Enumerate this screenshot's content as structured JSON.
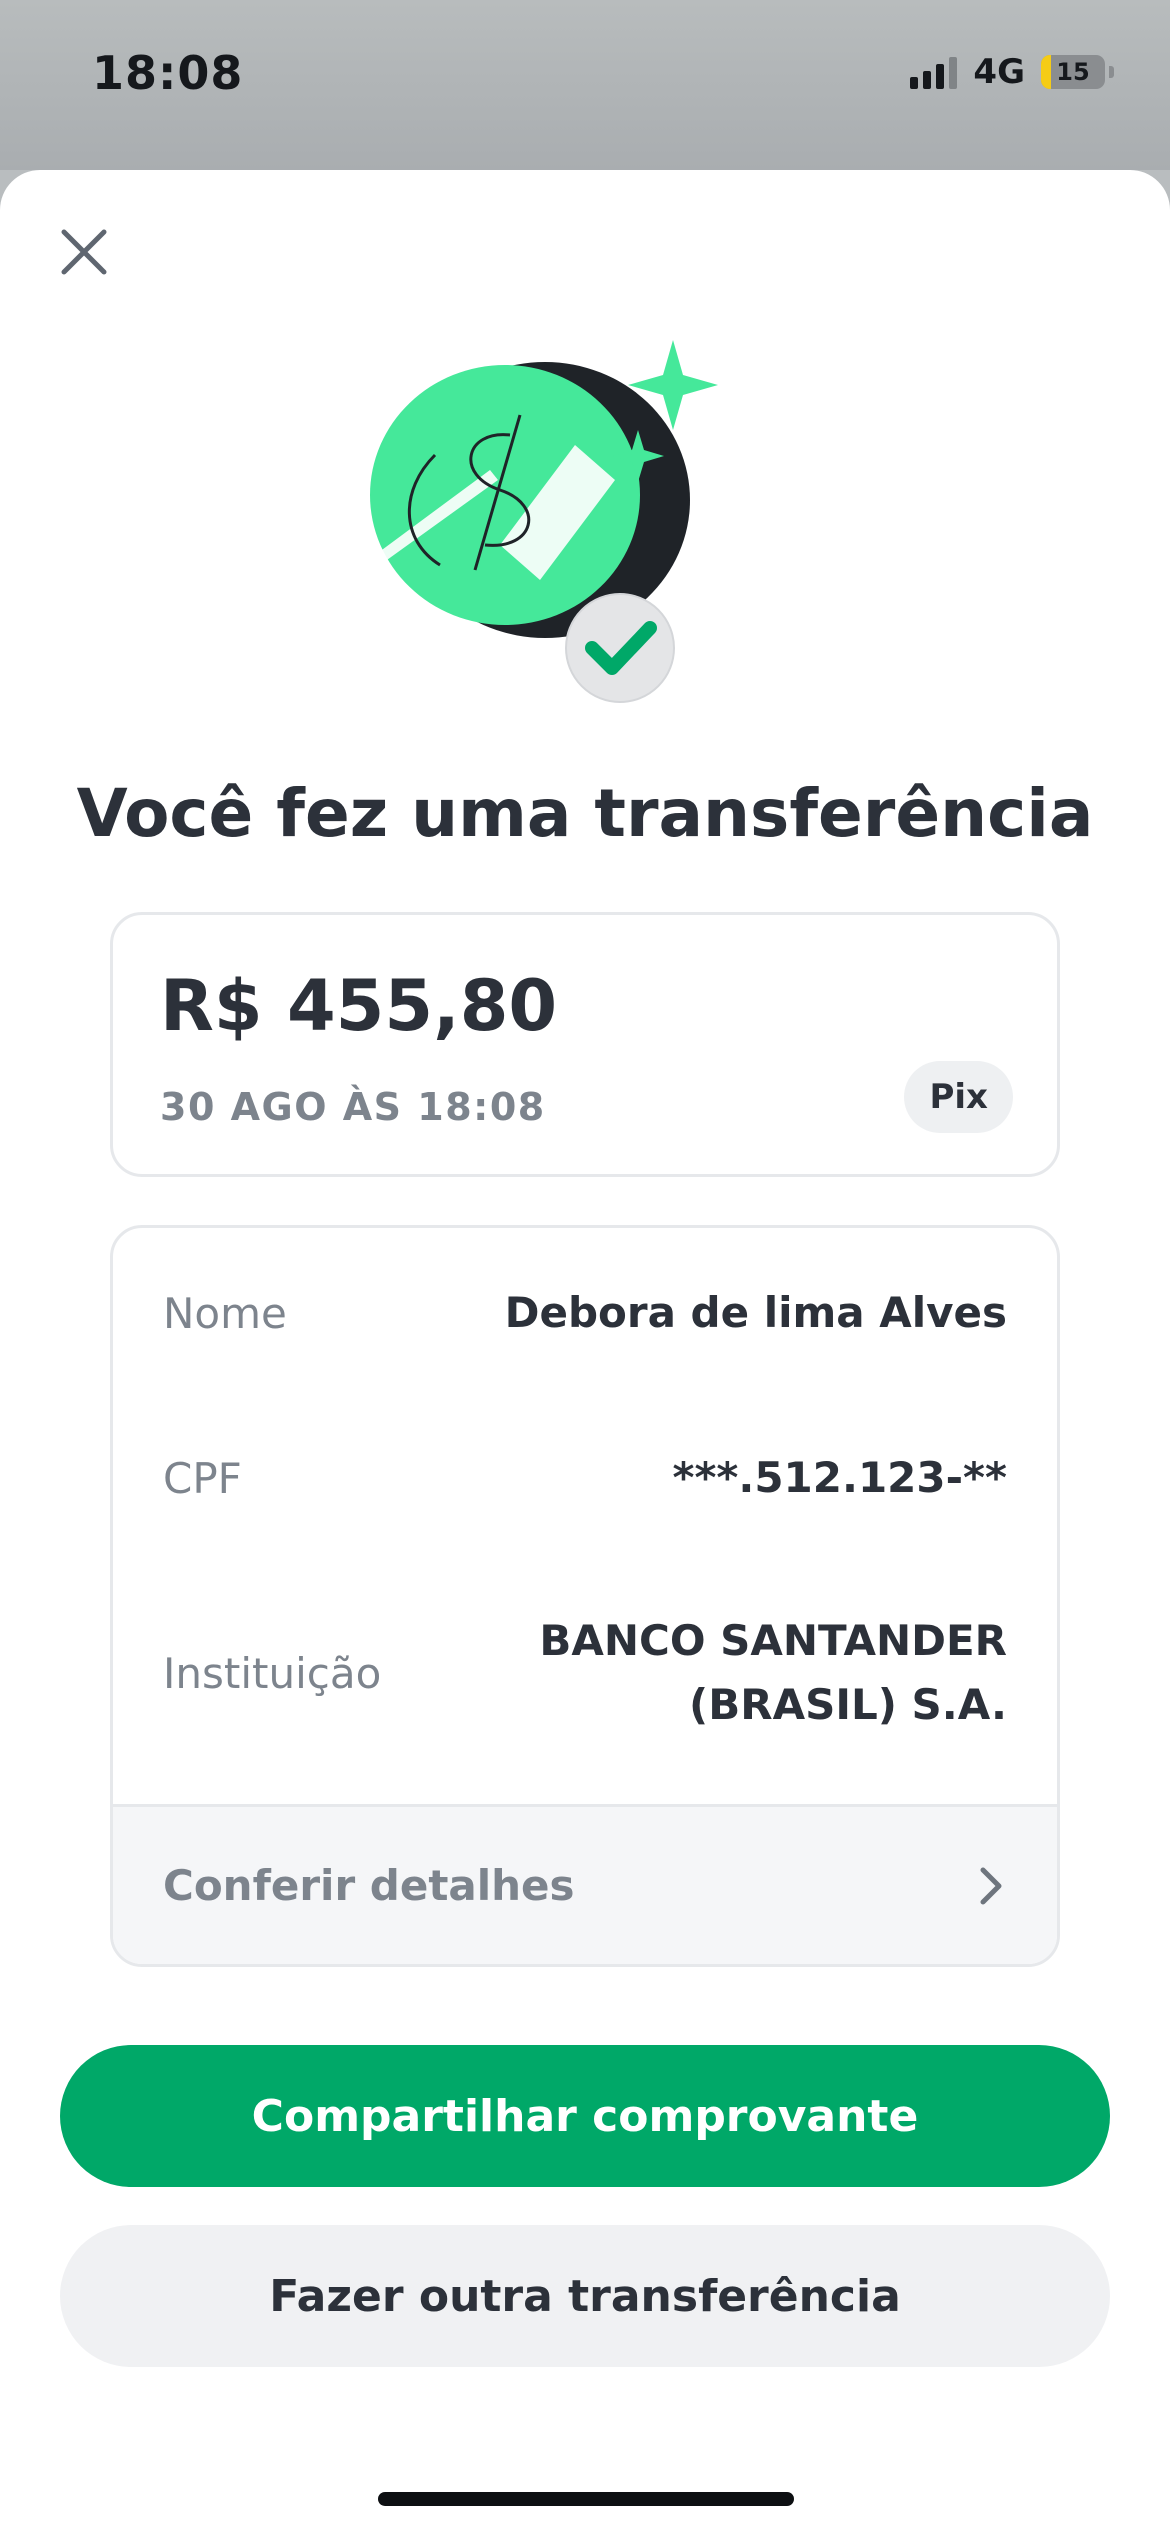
{
  "status_bar": {
    "time": "18:08",
    "network": "4G",
    "battery": "15",
    "battery_level": 0.15,
    "battery_color": "#f5cc16"
  },
  "close_icon": "close-icon",
  "title": "Você fez uma transferência",
  "transfer": {
    "amount": "R$ 455,80",
    "date": "30 AGO ÀS 18:08",
    "method": "Pix"
  },
  "details": {
    "rows": [
      {
        "label": "Nome",
        "value": "Debora de lima Alves"
      },
      {
        "label": "CPF",
        "value": "***.512.123-**"
      },
      {
        "label": "Instituição",
        "value_line1": "BANCO SANTANDER",
        "value_line2": "(BRASIL) S.A."
      }
    ],
    "footer_label": "Conferir detalhes",
    "footer_icon": "chevron-right-icon"
  },
  "buttons": {
    "primary": "Compartilhar comprovante",
    "secondary": "Fazer outra transferência"
  },
  "colors": {
    "accent_green": "#00a868",
    "illustration_green": "#45e89a",
    "text_dark": "#2c313a",
    "text_muted": "#7d848d"
  }
}
